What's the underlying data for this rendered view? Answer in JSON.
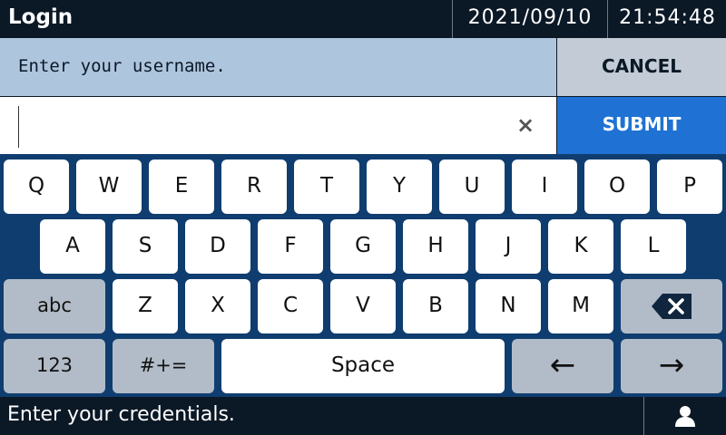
{
  "header": {
    "title": "Login",
    "date": "2021/09/10",
    "time": "21:54:48"
  },
  "prompt": {
    "text": "Enter your username.",
    "cancel_label": "CANCEL",
    "submit_label": "SUBMIT",
    "clear_symbol": "×"
  },
  "input": {
    "value": ""
  },
  "keyboard": {
    "row1": [
      "Q",
      "W",
      "E",
      "R",
      "T",
      "Y",
      "U",
      "I",
      "O",
      "P"
    ],
    "row2": [
      "A",
      "S",
      "D",
      "F",
      "G",
      "H",
      "J",
      "K",
      "L"
    ],
    "row3": [
      "Z",
      "X",
      "C",
      "V",
      "B",
      "N",
      "M"
    ],
    "shift_label": "abc",
    "numbers_label": "123",
    "symbols_label": "#+=",
    "space_label": "Space",
    "left_arrow": "←",
    "right_arrow": "→"
  },
  "status": {
    "message": "Enter your credentials."
  }
}
